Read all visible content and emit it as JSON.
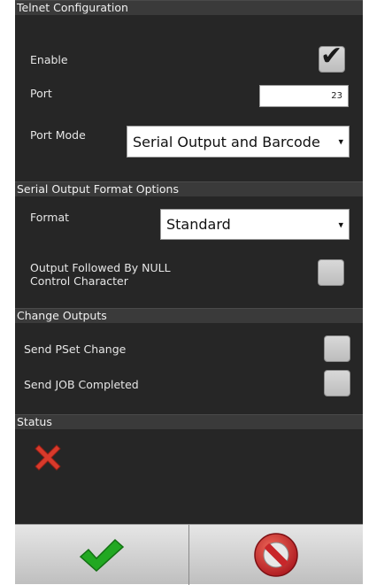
{
  "telnet": {
    "header": "Telnet Configuration",
    "enable_label": "Enable",
    "enable_checked": true,
    "port_label": "Port",
    "port_value": "23",
    "port_mode_label": "Port Mode",
    "port_mode_value": "Serial Output and Barcode"
  },
  "serial_output": {
    "header": "Serial Output Format Options",
    "format_label": "Format",
    "format_value": "Standard",
    "null_label_line1": "Output Followed By NULL",
    "null_label_line2": "Control Character",
    "null_checked": false
  },
  "change_outputs": {
    "header": "Change Outputs",
    "pset_label": "Send PSet Change",
    "pset_checked": false,
    "job_label": "Send JOB Completed",
    "job_checked": false
  },
  "status": {
    "header": "Status",
    "icon": "red-x-icon"
  },
  "footer": {
    "ok_icon": "green-check-icon",
    "cancel_icon": "cancel-icon"
  },
  "colors": {
    "panel_bg": "#262626",
    "header_bg": "#3a3a3a",
    "ok_green": "#22a822",
    "status_red": "#d93a2b",
    "cancel_red": "#c8262a"
  }
}
